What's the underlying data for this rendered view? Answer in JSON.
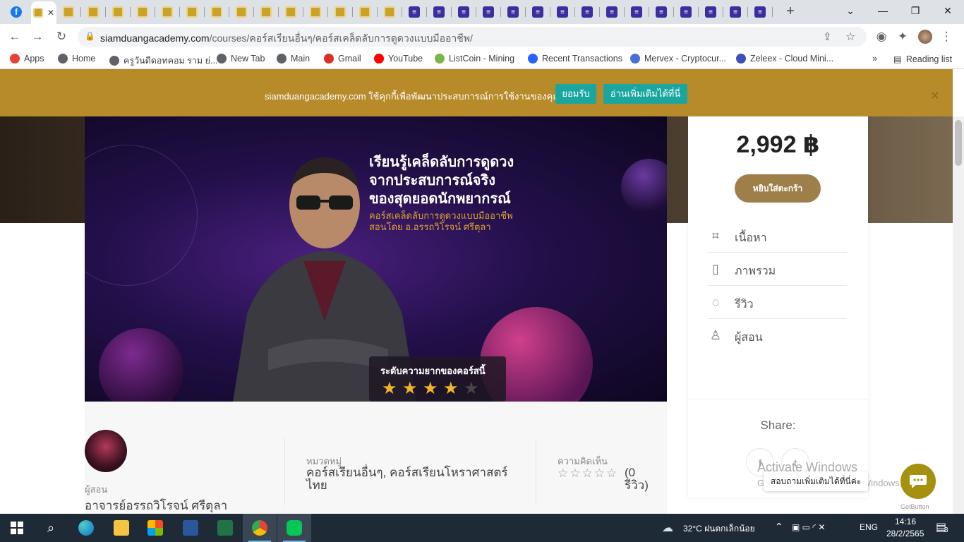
{
  "browser": {
    "tabs_siamduang_count": 14,
    "tabs_listcoin_count": 15,
    "new_tab_symbol": "+",
    "tab_menu_symbol": "⌄",
    "window": {
      "minimize": "—",
      "maximize": "❐",
      "close": "✕"
    },
    "url_domain": "siamduangacademy.com",
    "url_path": "/courses/คอร์สเรียนอื่นๆ/คอร์สเคล็ดลับการดูดวงแบบมืออาชีพ/",
    "bookmarks": [
      {
        "label": "Apps",
        "icon": "apps-grid-icon",
        "color": "#e94235"
      },
      {
        "label": "Home",
        "icon": "globe-icon",
        "color": "#5f6368"
      },
      {
        "label": "ครูวันดีดอทคอม ราม ย่...",
        "icon": "globe-icon",
        "color": "#5f6368"
      },
      {
        "label": "New Tab",
        "icon": "globe-icon",
        "color": "#5f6368"
      },
      {
        "label": "Main",
        "icon": "globe-icon",
        "color": "#5f6368"
      },
      {
        "label": "Gmail",
        "icon": "gmail-icon",
        "color": "#d93025"
      },
      {
        "label": "YouTube",
        "icon": "youtube-icon",
        "color": "#ff0000"
      },
      {
        "label": "ListCoin - Mining",
        "icon": "listcoin-icon",
        "color": "#7bb44a"
      },
      {
        "label": "Recent Transactions",
        "icon": "coin-icon",
        "color": "#2962ff"
      },
      {
        "label": "Mervex - Cryptocur...",
        "icon": "mervex-icon",
        "color": "#4a6fd6"
      },
      {
        "label": "Zeleex - Cloud Mini...",
        "icon": "zeleex-icon",
        "color": "#3f51b5"
      }
    ],
    "bookmarks_more": "»",
    "reading_list": "Reading list"
  },
  "cookie": {
    "text": "siamduangacademy.com ใช้คุกกี้เพื่อพัฒนาประสบการณ์การใช้งานของคุณ",
    "accept": "ยอมรับ",
    "more": "อ่านเพิ่มเติมได้ที่นี่",
    "close": "✕"
  },
  "banner": {
    "headline1": "เรียนรู้เคล็ดลับการดูดวง",
    "headline2": "จากประสบการณ์จริง",
    "headline3": "ของสุดยอดนักพยากรณ์",
    "sub1": "คอร์สเคล็ดลับการดูดวงแบบมืออาชีพ",
    "sub2": "สอนโดย อ.อรรถวิโรจน์ ศรีตุลา",
    "difficulty_label": "ระดับความยากของคอร์สนี้",
    "difficulty_stars": 4,
    "difficulty_max": 5
  },
  "meta": {
    "instructor_label": "ผู้สอน",
    "instructor_name": "อาจารย์อรรถวิโรจน์ ศรีตุลา",
    "category_label": "หมวดหมู่",
    "category_value": "คอร์สเรียนอื่นๆ, คอร์สเรียนโหราศาสตร์ไทย",
    "reviews_label": "ความคิดเห็น",
    "reviews_stars": "☆☆☆☆☆",
    "reviews_value": "(0 รีวิว)"
  },
  "sidebar": {
    "price": "2,992 ฿",
    "cart": "หยิบใส่ตะกร้า",
    "items": [
      {
        "label": "เนื้อหา",
        "icon": "tag-icon"
      },
      {
        "label": "ภาพรวม",
        "icon": "document-icon"
      },
      {
        "label": "รีวิว",
        "icon": "chat-icon"
      },
      {
        "label": "ผู้สอน",
        "icon": "user-icon"
      }
    ],
    "share": "Share:",
    "facebook": "f",
    "twitter": "t"
  },
  "overlay": {
    "activate1": "Activate Windows",
    "activate2": "Go to Settings to activate Windows.",
    "ask": "สอบถามเพิ่มเติมได้ที่นี่ค่ะ",
    "getbutton": "GetButton"
  },
  "taskbar": {
    "weather": "32°C ฝนตกเล็กน้อย",
    "lang": "ENG",
    "time": "14:16",
    "date": "28/2/2565",
    "notifications": "3"
  }
}
